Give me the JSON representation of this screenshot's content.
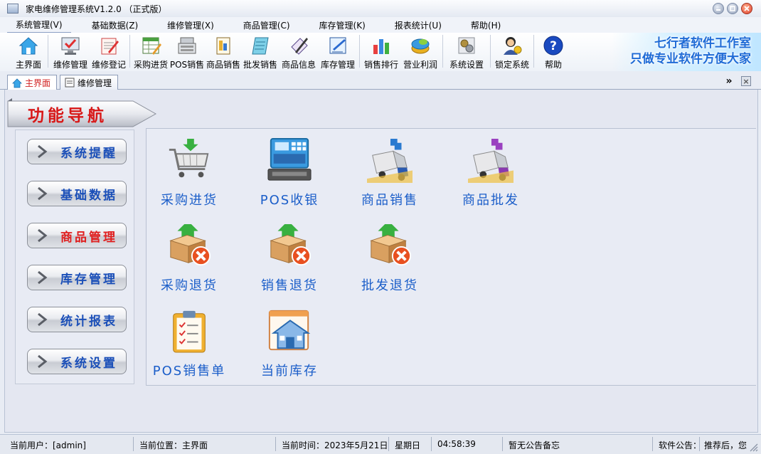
{
  "window": {
    "title": "家电维修管理系统V1.2.0 （正式版）"
  },
  "menu": [
    "系统管理(V)",
    "基础数据(Z)",
    "维修管理(X)",
    "商品管理(C)",
    "库存管理(K)",
    "报表统计(U)",
    "帮助(H)"
  ],
  "toolbar": {
    "items": [
      "主界面",
      "维修管理",
      "维修登记",
      "采购进货",
      "POS销售",
      "商品销售",
      "批发销售",
      "商品信息",
      "库存管理",
      "销售排行",
      "营业利润",
      "系统设置",
      "锁定系统",
      "帮助"
    ],
    "slogan_line1": "七行者软件工作室",
    "slogan_line2": "只做专业软件方便大家"
  },
  "tabs": [
    "主界面",
    "维修管理"
  ],
  "tab_controls": {
    "more": "»",
    "close": "×"
  },
  "banner": {
    "title": "功能导航"
  },
  "nav": [
    "系统提醒",
    "基础数据",
    "商品管理",
    "库存管理",
    "统计报表",
    "系统设置"
  ],
  "nav_selected": "商品管理",
  "functions": [
    "采购进货",
    "POS收银",
    "商品销售",
    "商品批发",
    "采购退货",
    "销售退货",
    "批发退货",
    "POS销售单",
    "当前库存"
  ],
  "status": {
    "user": "当前用户：[admin]",
    "location": "当前位置：主界面",
    "time": "当前时间：2023年5月21日",
    "weekday": "星期日",
    "clock": "04:58:39",
    "memo": "暂无公告备忘",
    "notice_label": "软件公告：",
    "notice": "推荐后，您"
  },
  "colors": {
    "accent_blue": "#1b5ec9",
    "selected_red": "#e02020",
    "banner_red": "#d81818"
  }
}
